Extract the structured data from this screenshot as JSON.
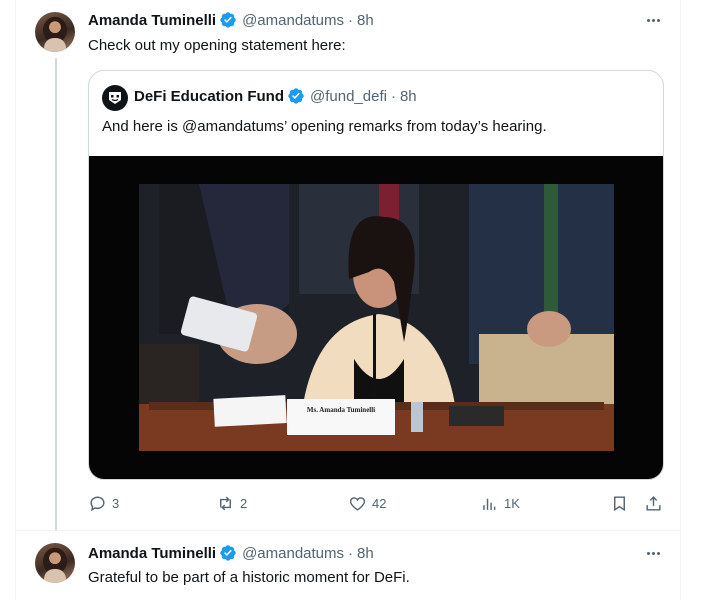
{
  "tweet1": {
    "display_name": "Amanda Tuminelli",
    "handle": "@amandatums",
    "separator": "·",
    "time": "8h",
    "text": "Check out my opening statement here:"
  },
  "quote": {
    "display_name": "DeFi Education Fund",
    "handle": "@fund_defi",
    "separator": "·",
    "time": "8h",
    "text": "And here is @amandatums’ opening remarks from today’s hearing.",
    "nameplate_text": "Ms. Amanda Tuminelli"
  },
  "actions": {
    "replies": "3",
    "reposts": "2",
    "likes": "42",
    "views": "1K"
  },
  "tweet2": {
    "display_name": "Amanda Tuminelli",
    "handle": "@amandatums",
    "separator": "·",
    "time": "8h",
    "text": "Grateful to be part of a historic moment for DeFi."
  },
  "colors": {
    "verified_badge": "#1d9bf0",
    "text_primary": "#0f1419",
    "text_secondary": "#536471",
    "border": "#cfd9de"
  },
  "icons": [
    "verified-icon",
    "more-icon",
    "reply-icon",
    "repost-icon",
    "like-icon",
    "views-icon",
    "bookmark-icon",
    "share-icon"
  ]
}
